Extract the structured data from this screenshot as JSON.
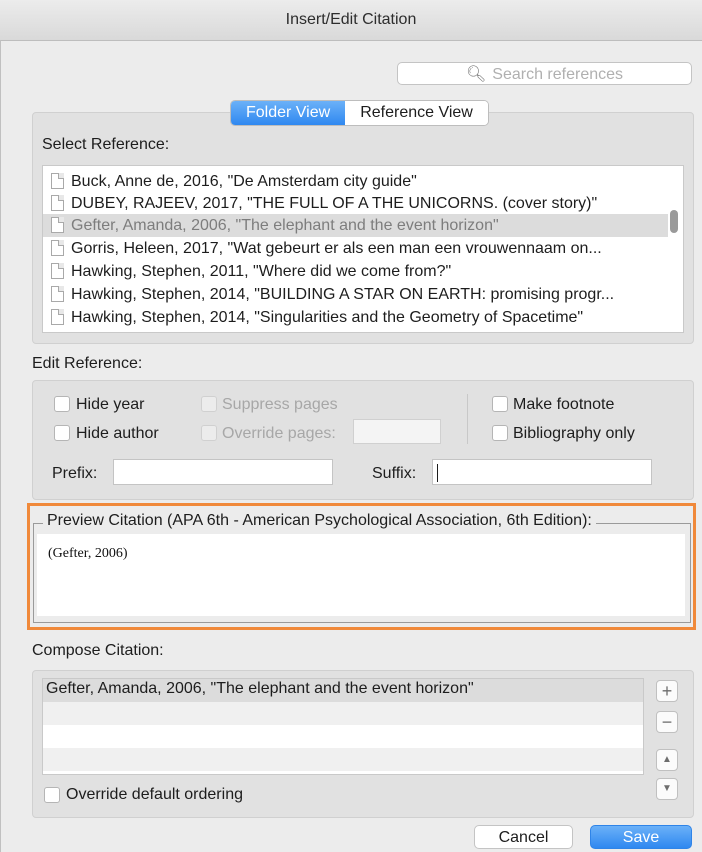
{
  "window": {
    "title": "Insert/Edit Citation"
  },
  "search": {
    "placeholder": "Search references",
    "icon": "search-icon"
  },
  "view_toggle": {
    "folder_view": "Folder View",
    "reference_view": "Reference View",
    "active": "Folder View"
  },
  "select_reference": {
    "label": "Select Reference:",
    "items": [
      "Buck, Anne de, 2016, \"De Amsterdam city guide\"",
      "DUBEY, RAJEEV, 2017, \"THE FULL OF A THE UNICORNS. (cover story)\"",
      "Gefter, Amanda, 2006, \"The elephant and the event horizon\"",
      "Gorris, Heleen, 2017, \"Wat gebeurt er als een man een vrouwennaam on...",
      "Hawking, Stephen, 2011, \"Where did we come from?\"",
      "Hawking, Stephen, 2014, \"BUILDING A STAR ON EARTH: promising progr...",
      "Hawking, Stephen, 2014, \"Singularities and the Geometry of Spacetime\""
    ],
    "selected_index": 2
  },
  "edit_reference": {
    "label": "Edit Reference:",
    "hide_year": "Hide year",
    "hide_author": "Hide author",
    "suppress_pages": "Suppress pages",
    "override_pages": "Override pages:",
    "make_footnote": "Make footnote",
    "bibliography_only": "Bibliography only",
    "prefix_label": "Prefix:",
    "suffix_label": "Suffix:",
    "prefix_value": "",
    "suffix_value": "",
    "override_pages_value": ""
  },
  "preview": {
    "legend": "Preview Citation (APA 6th - American Psychological Association, 6th Edition):",
    "text": "(Gefter, 2006)"
  },
  "compose": {
    "label": "Compose Citation:",
    "items": [
      "Gefter, Amanda, 2006, \"The elephant and the event horizon\""
    ],
    "add": "+",
    "remove": "−",
    "override_ordering": "Override default ordering"
  },
  "buttons": {
    "cancel": "Cancel",
    "save": "Save"
  },
  "colors": {
    "accent": "#2f88f0",
    "highlight_outline": "#f0893a"
  }
}
